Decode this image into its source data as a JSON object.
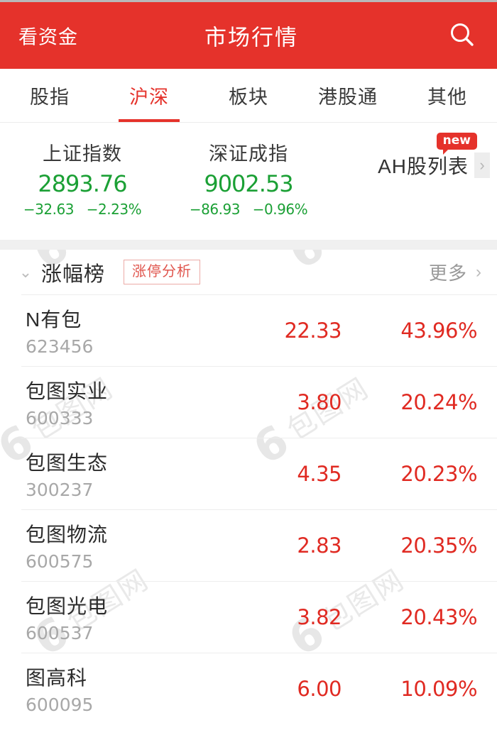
{
  "theme": {
    "brand_red": "#e5322b",
    "down_green": "#1ba035",
    "up_red": "#e02a22",
    "muted_gray": "#a8a8a8"
  },
  "watermark": {
    "logo_glyph": "6",
    "text": "包图网"
  },
  "header": {
    "left_action": "看资金",
    "title": "市场行情",
    "search_icon": "search-icon"
  },
  "tabs": [
    {
      "label": "股指",
      "active": false
    },
    {
      "label": "沪深",
      "active": true
    },
    {
      "label": "板块",
      "active": false
    },
    {
      "label": "港股通",
      "active": false
    },
    {
      "label": "其他",
      "active": false
    }
  ],
  "indices": [
    {
      "name": "上证指数",
      "value": "2893.76",
      "change": "−32.63",
      "change_pct": "−2.23%"
    },
    {
      "name": "深证成指",
      "value": "9002.53",
      "change": "−86.93",
      "change_pct": "−0.96%"
    }
  ],
  "ah_entry": {
    "label": "AH股列表",
    "badge": "new",
    "chevron": "›"
  },
  "section": {
    "collapse_icon": "⌄",
    "title": "涨幅榜",
    "tag_label": "涨停分析",
    "more_label": "更多",
    "more_chevron": "›"
  },
  "stocks": [
    {
      "name": "N有包",
      "code": "623456",
      "price": "22.33",
      "change_pct": "43.96%"
    },
    {
      "name": "包图实业",
      "code": "600333",
      "price": "3.80",
      "change_pct": "20.24%"
    },
    {
      "name": "包图生态",
      "code": "300237",
      "price": "4.35",
      "change_pct": "20.23%"
    },
    {
      "name": "包图物流",
      "code": "600575",
      "price": "2.83",
      "change_pct": "20.35%"
    },
    {
      "name": "包图光电",
      "code": "600537",
      "price": "3.82",
      "change_pct": "20.43%"
    },
    {
      "name": "图高科",
      "code": "600095",
      "price": "6.00",
      "change_pct": "10.09%"
    }
  ]
}
